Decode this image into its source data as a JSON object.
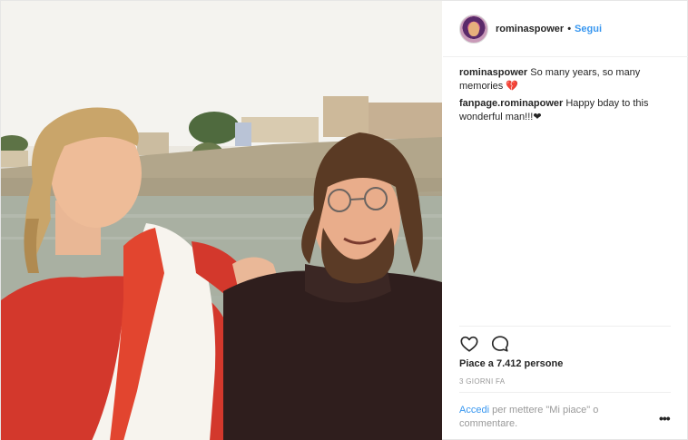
{
  "header": {
    "username": "rominaspower",
    "separator": "•",
    "follow_label": "Segui"
  },
  "comments": [
    {
      "username": "rominaspower",
      "text": "So many years, so many memories",
      "emoji": "💔"
    },
    {
      "username": "fanpage.rominapower",
      "text": "Happy bday to this wonderful man!!!",
      "emoji": "❤"
    }
  ],
  "actions": {
    "like_icon": "heart-outline-icon",
    "comment_icon": "speech-bubble-icon"
  },
  "likes": {
    "text": "Piace a 7.412 persone"
  },
  "timestamp": "3 GIORNI FA",
  "login_prompt": {
    "link": "Accedi",
    "text": "per mettere \"Mi piace\" o commentare."
  },
  "more_label": "•••",
  "colors": {
    "link_blue": "#3897f0",
    "text": "#262626",
    "muted": "#999999",
    "saree_red": "#d0362b"
  }
}
